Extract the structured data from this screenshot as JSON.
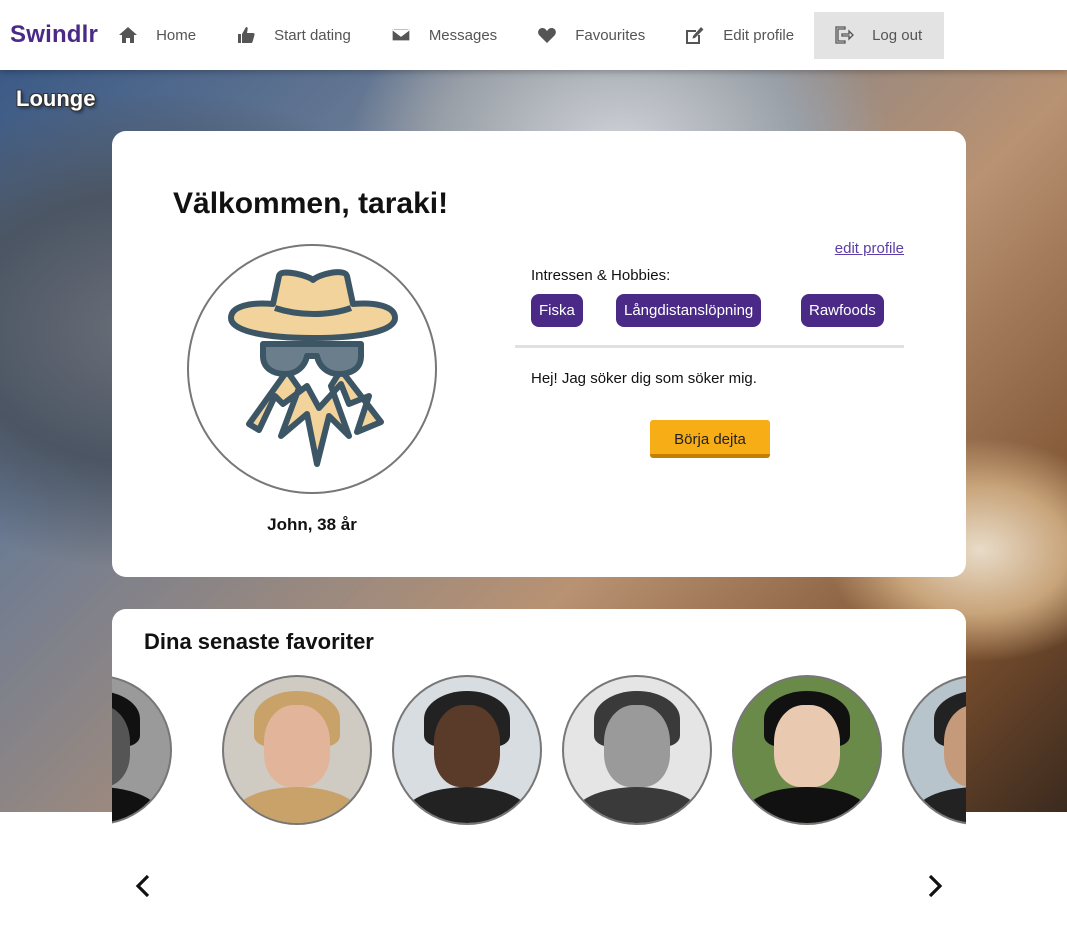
{
  "nav": {
    "brand": "Swindlr",
    "items": [
      {
        "label": "Home",
        "icon": "home-icon"
      },
      {
        "label": "Start dating",
        "icon": "thumbs-up-icon"
      },
      {
        "label": "Messages",
        "icon": "envelope-icon"
      },
      {
        "label": "Favourites",
        "icon": "heart-icon"
      },
      {
        "label": "Edit profile",
        "icon": "edit-icon"
      },
      {
        "label": "Log out",
        "icon": "logout-icon"
      }
    ]
  },
  "page": {
    "section_title": "Lounge"
  },
  "profile": {
    "welcome": "Välkommen, taraki!",
    "name_age": "John, 38 år",
    "edit_link": "edit profile",
    "interests_label": "Intressen & Hobbies:",
    "interests": [
      "Fiska",
      "Långdistanslöpning",
      "Rawfoods"
    ],
    "bio": "Hej! Jag söker dig som söker mig.",
    "cta_label": "Börja dejta",
    "avatar_icon": "spy-avatar-icon"
  },
  "favourites": {
    "title": "Dina senaste favoriter",
    "items": [
      {
        "name": "fav-1",
        "bg": "#9a9a9a",
        "skin": "#555",
        "hair": "#111"
      },
      {
        "name": "fav-2",
        "bg": "#cfcac2",
        "skin": "#e2b49a",
        "hair": "#c9a26a"
      },
      {
        "name": "fav-3",
        "bg": "#d8dde2",
        "skin": "#5a3a28",
        "hair": "#222"
      },
      {
        "name": "fav-4",
        "bg": "#e5e5e5",
        "skin": "#9a9a9a",
        "hair": "#3a3a3a"
      },
      {
        "name": "fav-5",
        "bg": "#6a8a4a",
        "skin": "#e9c9b0",
        "hair": "#111"
      },
      {
        "name": "fav-6",
        "bg": "#b8c4cc",
        "skin": "#c59a7a",
        "hair": "#222"
      }
    ],
    "prev_icon": "chevron-left-icon",
    "next_icon": "chevron-right-icon"
  },
  "colors": {
    "brand": "#4a2a86",
    "chip": "#4a2a86",
    "cta": "#f7ad16",
    "link": "#5b3ea8"
  }
}
